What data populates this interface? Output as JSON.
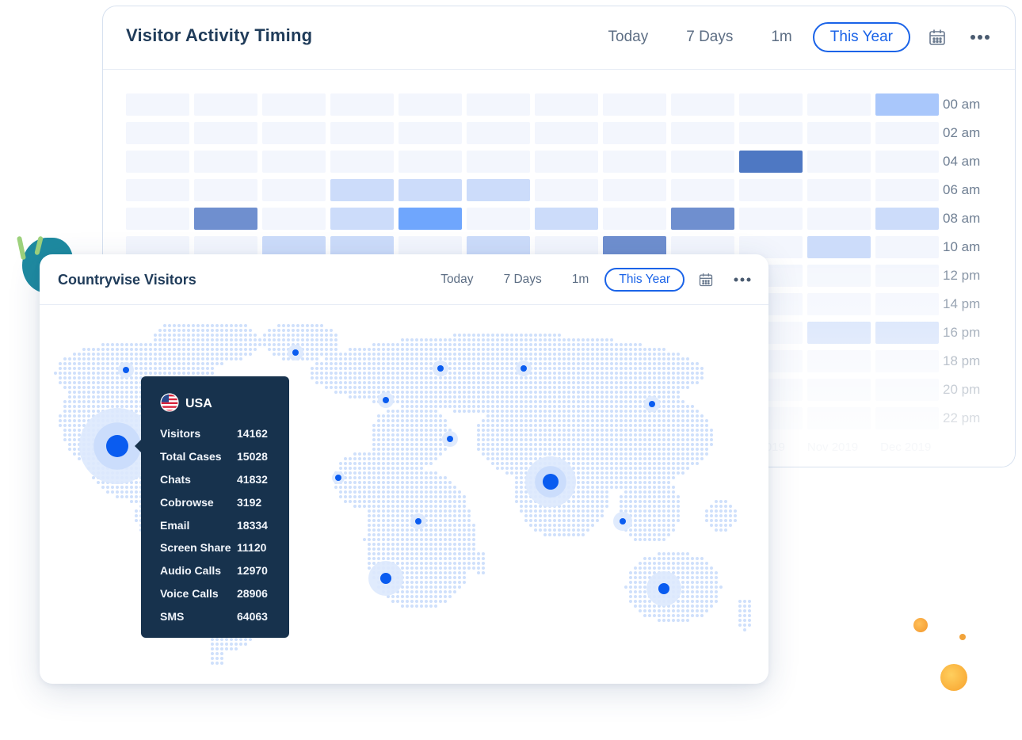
{
  "activity_card": {
    "title": "Visitor Activity Timing",
    "filters": [
      {
        "label": "Today",
        "active": false
      },
      {
        "label": "7 Days",
        "active": false
      },
      {
        "label": "1m",
        "active": false
      },
      {
        "label": "This Year",
        "active": true
      }
    ],
    "calendar_icon": "calendar-icon",
    "more_icon": "more-horizontal-icon",
    "hour_labels": [
      "00 am",
      "02 am",
      "04 am",
      "06 am",
      "08 am",
      "10 am",
      "12 pm",
      "14 pm",
      "16 pm",
      "18 pm",
      "20 pm",
      "22 pm"
    ],
    "month_labels": [
      "Oct 2019",
      "Nov 2019",
      "Dec 2019"
    ],
    "heatmap_levels": [
      [
        0,
        0,
        0,
        0,
        0,
        0,
        0,
        0,
        0,
        0,
        0,
        2
      ],
      [
        0,
        0,
        0,
        0,
        0,
        0,
        0,
        0,
        0,
        0,
        0,
        0
      ],
      [
        0,
        0,
        0,
        0,
        0,
        0,
        0,
        0,
        0,
        5,
        0,
        0
      ],
      [
        0,
        0,
        0,
        1,
        1,
        1,
        0,
        0,
        0,
        0,
        0,
        0
      ],
      [
        0,
        4,
        0,
        1,
        3,
        0,
        1,
        0,
        4,
        0,
        0,
        1
      ],
      [
        0,
        0,
        1,
        1,
        0,
        1,
        0,
        4,
        0,
        0,
        1,
        0
      ],
      [
        0,
        0,
        0,
        0,
        0,
        0,
        0,
        0,
        0,
        0,
        0,
        0
      ],
      [
        0,
        0,
        0,
        0,
        0,
        0,
        0,
        0,
        0,
        0,
        0,
        0
      ],
      [
        0,
        0,
        0,
        0,
        0,
        0,
        0,
        0,
        0,
        0,
        1,
        1
      ],
      [
        0,
        0,
        0,
        0,
        0,
        0,
        0,
        0,
        0,
        0,
        0,
        0
      ],
      [
        0,
        0,
        0,
        0,
        0,
        0,
        0,
        0,
        0,
        0,
        0,
        0
      ],
      [
        0,
        0,
        0,
        0,
        0,
        0,
        0,
        0,
        0,
        0,
        0,
        0
      ]
    ],
    "colors": {
      "level0": "#f3f6fd",
      "level1": "#ccdcfa",
      "level2": "#a9c7fb",
      "level3": "#6fa6fd",
      "level4": "#6f8fcf",
      "level5": "#4e78c3",
      "accent": "#1a63e8"
    }
  },
  "country_card": {
    "title": "Countryvise Visitors",
    "filters": [
      {
        "label": "Today",
        "active": false
      },
      {
        "label": "7 Days",
        "active": false
      },
      {
        "label": "1m",
        "active": false
      },
      {
        "label": "This Year",
        "active": true
      }
    ],
    "calendar_icon": "calendar-icon",
    "more_icon": "more-horizontal-icon",
    "map_colors": {
      "dot": "#cfe0fb",
      "marker": "#0a5cf0",
      "halo": "#dde9fd"
    },
    "tooltip": {
      "flag_icon": "us-flag-icon",
      "country": "USA",
      "rows": [
        {
          "label": "Visitors",
          "value": "14162"
        },
        {
          "label": "Total Cases",
          "value": "15028"
        },
        {
          "label": "Chats",
          "value": "41832"
        },
        {
          "label": "Cobrowse",
          "value": "3192"
        },
        {
          "label": "Email",
          "value": "18334"
        },
        {
          "label": "Screen Share",
          "value": "11120"
        },
        {
          "label": "Audio Calls",
          "value": "12970"
        },
        {
          "label": "Voice Calls",
          "value": "28906"
        },
        {
          "label": "SMS",
          "value": "64063"
        }
      ]
    }
  }
}
